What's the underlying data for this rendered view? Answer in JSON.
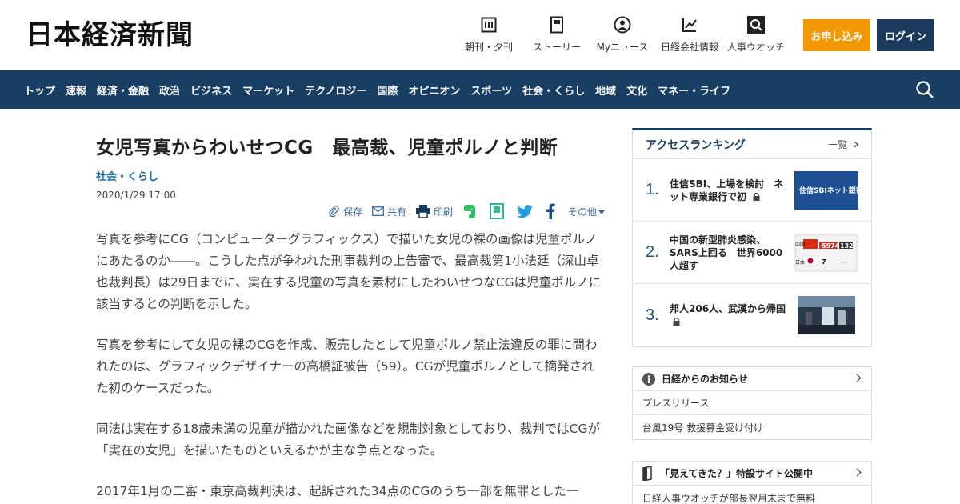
{
  "header": {
    "logo": "日本経済新聞",
    "nav_icons": [
      {
        "label": "朝刊・夕刊",
        "icon": "newspaper-icon"
      },
      {
        "label": "ストーリー",
        "icon": "story-icon"
      },
      {
        "label": "Myニュース",
        "icon": "person-icon"
      },
      {
        "label": "日経会社情報",
        "icon": "company-chart-icon"
      },
      {
        "label": "人事ウオッチ",
        "icon": "search-person-icon"
      }
    ],
    "apply_label": "お申し込み",
    "login_label": "ログイン"
  },
  "nav": {
    "items": [
      "トップ",
      "速報",
      "経済・金融",
      "政治",
      "ビジネス",
      "マーケット",
      "テクノロジー",
      "国際",
      "オピニオン",
      "スポーツ",
      "社会・くらし",
      "地域",
      "文化",
      "マネー・ライフ"
    ]
  },
  "article": {
    "headline": "女児写真からわいせつCG　最高裁、児童ポルノと判断",
    "category": "社会・くらし",
    "datetime": "2020/1/29 17:00",
    "tools": {
      "save": "保存",
      "share": "共有",
      "print": "印刷",
      "more": "その他"
    },
    "paragraphs": [
      "写真を参考にCG（コンピューターグラフィックス）で描いた女児の裸の画像は児童ポルノにあたるのか――。こうした点が争われた刑事裁判の上告審で、最高裁第1小法廷（深山卓也裁判長）は29日までに、実在する児童の写真を素材にしたわいせつなCGは児童ポルノに該当するとの判断を示した。",
      "写真を参考にして女児の裸のCGを作成、販売したとして児童ポルノ禁止法違反の罪に問われたのは、グラフィックデザイナーの高橋証被告（59）。CGが児童ポルノとして摘発された初のケースだった。",
      "同法は実在する18歳未満の児童が描かれた画像などを規制対象としており、裁判ではCGが「実在の女児」を描いたものといえるかが主な争点となった。",
      "2017年1月の二審・東京高裁判決は、起訴された34点のCGのうち一部を無罪とした一"
    ]
  },
  "sidebar": {
    "ranking": {
      "title": "アクセスランキング",
      "more": "一覧",
      "items": [
        {
          "rank": "1.",
          "text": "住信SBI、上場を検討　ネット専業銀行で初"
        },
        {
          "rank": "2.",
          "text": "中国の新型肺炎感染、SARS上回る　世界6000人超す"
        },
        {
          "rank": "3.",
          "text": "邦人206人、武漢から帰国"
        }
      ]
    },
    "notice": {
      "title": "日経からのお知らせ",
      "rows": [
        "プレスリリース",
        "台風19号 救援募金受け付け"
      ]
    },
    "promo": {
      "title": "「見えてきた？」特設サイト公開中",
      "rows": [
        "日経人事ウオッチが部長翌月末まで無料"
      ]
    },
    "thumbs": {
      "bank_sign": "住信SBIネット銀行",
      "board_labels": [
        "中国",
        "日本"
      ],
      "board_values": [
        "5974",
        "132",
        "7",
        "―"
      ]
    }
  },
  "colors": {
    "navy": "#183e63",
    "orange": "#f39800",
    "link_blue": "#1b6fa8"
  }
}
